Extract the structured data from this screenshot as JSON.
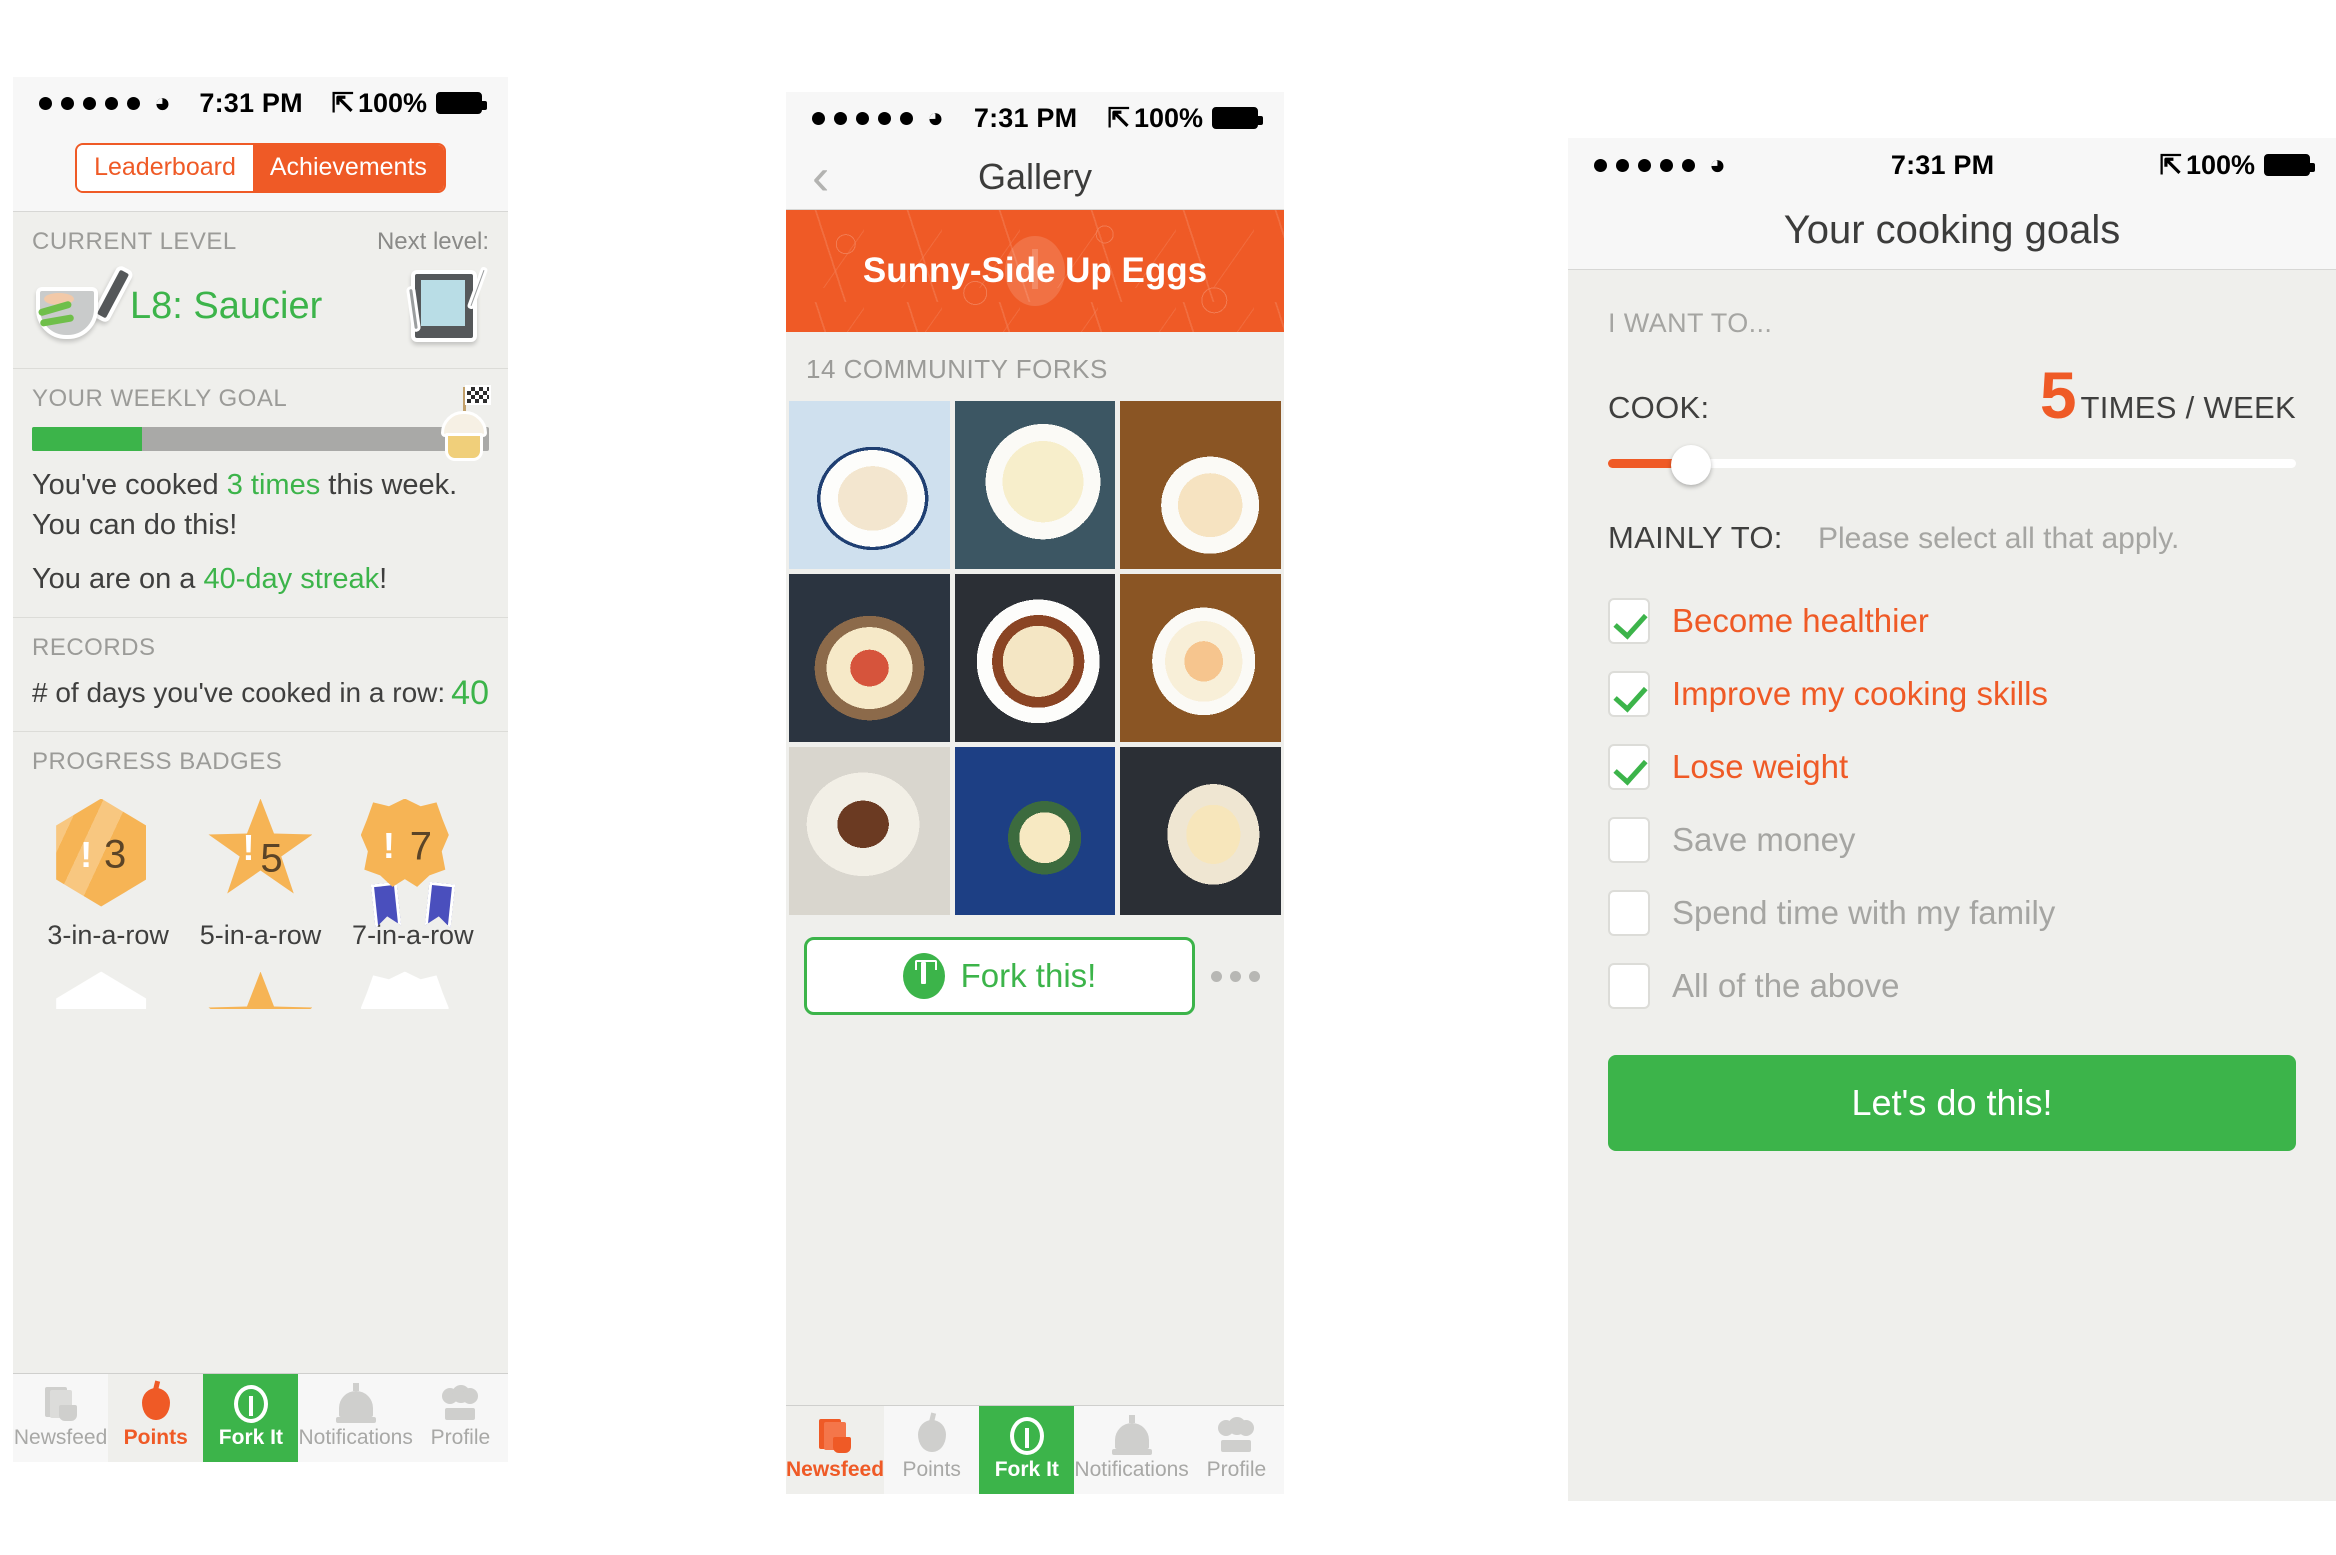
{
  "status_bar": {
    "time": "7:31 PM",
    "battery": "100%",
    "signal_dots": 5,
    "bluetooth": "bluetooth-icon",
    "wifi": "wifi-icon"
  },
  "phone1": {
    "segmented": {
      "leaderboard": "Leaderboard",
      "achievements": "Achievements",
      "selected": "Achievements"
    },
    "current_level": {
      "label": "CURRENT LEVEL",
      "next_label": "Next level:",
      "value": "L8: Saucier",
      "icon": "frying-pan-badge",
      "next_icon": "tablet-badge"
    },
    "weekly_goal": {
      "label": "YOUR WEEKLY GOAL",
      "progress_percent": 24,
      "goal_icon": "cupcake-flag-icon",
      "line1_a": "You've cooked ",
      "line1_b": "3 times",
      "line1_c": " this week. You can do this!",
      "line2_a": "You are on a ",
      "line2_b": "40-day streak",
      "line2_c": "!"
    },
    "records": {
      "label": "RECORDS",
      "row_label": "# of days you've cooked in a row:",
      "row_value": "40"
    },
    "badges": {
      "label": "PROGRESS BADGES",
      "items": [
        {
          "num": "3",
          "caption": "3-in-a-row",
          "shape": "hexagon"
        },
        {
          "num": "5",
          "caption": "5-in-a-row",
          "shape": "star"
        },
        {
          "num": "7",
          "caption": "7-in-a-row",
          "shape": "rosette"
        }
      ]
    },
    "tabs": [
      {
        "label": "Newsfeed",
        "icon": "newspaper-mug-icon",
        "state": "inactive"
      },
      {
        "label": "Points",
        "icon": "apple-icon",
        "state": "tint"
      },
      {
        "label": "Fork It",
        "icon": "fork-circle-icon",
        "state": "active"
      },
      {
        "label": "Notifications",
        "icon": "service-bell-icon",
        "state": "inactive"
      },
      {
        "label": "Profile",
        "icon": "chef-hat-icon",
        "state": "inactive"
      }
    ]
  },
  "phone2": {
    "nav": {
      "title": "Gallery",
      "back": "back-chevron-icon"
    },
    "hero": {
      "title": "Sunny-Side Up Eggs"
    },
    "forks_count": "14 COMMUNITY FORKS",
    "photos": [
      "egg-quinoa-blue-rim-bowl",
      "egg-on-chorizo-white-bowl",
      "egg-in-bowl-wood-table",
      "eggs-tomato-toast-plate",
      "eggs-bacon-white-plate",
      "egg-in-white-bowl-wood",
      "toast-and-eggs-white-plate",
      "avocado-beans-eggs-blue-plate",
      "eggs-and-bread-plate"
    ],
    "fork_button": {
      "label": "Fork this!",
      "icon": "fork-circle-icon"
    },
    "more": "more-options-icon",
    "tabs": [
      {
        "label": "Newsfeed",
        "icon": "newspaper-mug-icon",
        "state": "tint"
      },
      {
        "label": "Points",
        "icon": "apple-icon",
        "state": "inactive"
      },
      {
        "label": "Fork It",
        "icon": "fork-circle-icon",
        "state": "active"
      },
      {
        "label": "Notifications",
        "icon": "service-bell-icon",
        "state": "inactive"
      },
      {
        "label": "Profile",
        "icon": "chef-hat-icon",
        "state": "inactive"
      }
    ]
  },
  "phone3": {
    "nav": {
      "title": "Your cooking goals"
    },
    "kicker": "I WANT TO...",
    "cook": {
      "label": "COOK:",
      "value": "5",
      "unit": "TIMES / WEEK",
      "slider_percent": 12
    },
    "mainly": {
      "label": "MAINLY TO:",
      "hint": "Please select all that apply."
    },
    "goals": [
      {
        "label": "Become healthier",
        "checked": true
      },
      {
        "label": "Improve my cooking skills",
        "checked": true
      },
      {
        "label": "Lose weight",
        "checked": true
      },
      {
        "label": "Save money",
        "checked": false
      },
      {
        "label": "Spend time with my family",
        "checked": false
      },
      {
        "label": "All of the above",
        "checked": false
      }
    ],
    "cta": "Let's do this!"
  },
  "colors": {
    "orange": "#ef5a26",
    "green": "#3cb44a",
    "gold": "#f6b455",
    "gray_bg": "#efefec",
    "text": "#3f3f3e"
  }
}
